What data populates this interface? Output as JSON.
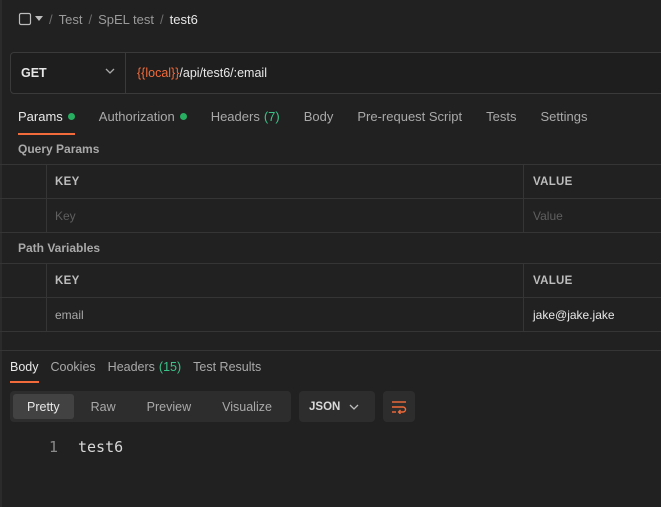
{
  "breadcrumb": {
    "items": [
      "Test",
      "SpEL test"
    ],
    "current": "test6"
  },
  "request": {
    "method": "GET",
    "url_variable": "{{local}}",
    "url_path": "/api/test6/:email"
  },
  "request_tabs": [
    {
      "label": "Params",
      "active": true,
      "dot": true
    },
    {
      "label": "Authorization",
      "dot": true
    },
    {
      "label": "Headers",
      "count": "(7)"
    },
    {
      "label": "Body"
    },
    {
      "label": "Pre-request Script"
    },
    {
      "label": "Tests"
    },
    {
      "label": "Settings"
    }
  ],
  "query_params": {
    "title": "Query Params",
    "headers": [
      "KEY",
      "VALUE"
    ],
    "placeholder_row": [
      "Key",
      "Value"
    ]
  },
  "path_variables": {
    "title": "Path Variables",
    "headers": [
      "KEY",
      "VALUE"
    ],
    "rows": [
      {
        "key": "email",
        "value": "jake@jake.jake"
      }
    ]
  },
  "response_tabs": [
    {
      "label": "Body",
      "active": true
    },
    {
      "label": "Cookies"
    },
    {
      "label": "Headers",
      "count": "(15)"
    },
    {
      "label": "Test Results"
    }
  ],
  "view_modes": [
    "Pretty",
    "Raw",
    "Preview",
    "Visualize"
  ],
  "active_view": "Pretty",
  "format": "JSON",
  "response_body": [
    {
      "line": "1",
      "text": "test6"
    }
  ],
  "colors": {
    "accent": "#f26b3a",
    "success": "#27ae60",
    "count": "#3cc38a",
    "background": "#212121"
  }
}
